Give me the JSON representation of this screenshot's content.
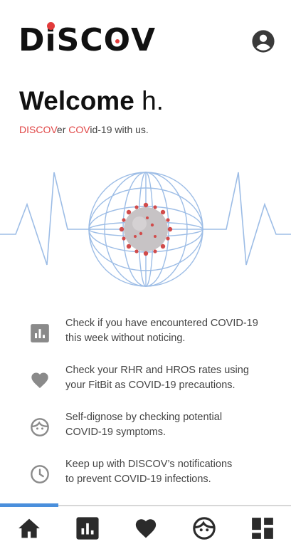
{
  "header": {
    "logo_before": "D",
    "logo_i": "i",
    "logo_mid": "SC",
    "logo_o": "O",
    "logo_after": "V",
    "account_icon": "account-circle-icon"
  },
  "welcome": {
    "greeting": "Welcome",
    "name": "h."
  },
  "tagline": {
    "part1": "DISCOV",
    "part2": "er ",
    "part3": "COV",
    "part4": "id-19 with us."
  },
  "features": [
    {
      "icon": "bar-chart-icon",
      "line1": "Check if you have encountered COVID-19",
      "line2": "this week without noticing."
    },
    {
      "icon": "heart-icon",
      "line1": "Check your RHR and HROS rates using",
      "line2": "your FitBit as COVID-19 precautions."
    },
    {
      "icon": "face-icon",
      "line1": "Self-dignose by checking potential",
      "line2": "COVID-19 symptoms."
    },
    {
      "icon": "clock-icon",
      "line1": "Keep up with DISCOV’s notifications",
      "line2": "to prevent COVID-19 infections."
    }
  ],
  "progress": {
    "fraction": 0.2
  },
  "bottom_nav": [
    {
      "icon": "home-icon",
      "active": true
    },
    {
      "icon": "bar-chart-icon",
      "active": false
    },
    {
      "icon": "heart-icon",
      "active": false
    },
    {
      "icon": "face-icon",
      "active": false
    },
    {
      "icon": "dashboard-icon",
      "active": false
    }
  ],
  "colors": {
    "accent_red": "#e04545",
    "accent_blue": "#4a8fdc",
    "globe_line": "#9dbde6",
    "icon_gray": "#8a8a8a",
    "nav_icon": "#2b2b2b"
  }
}
